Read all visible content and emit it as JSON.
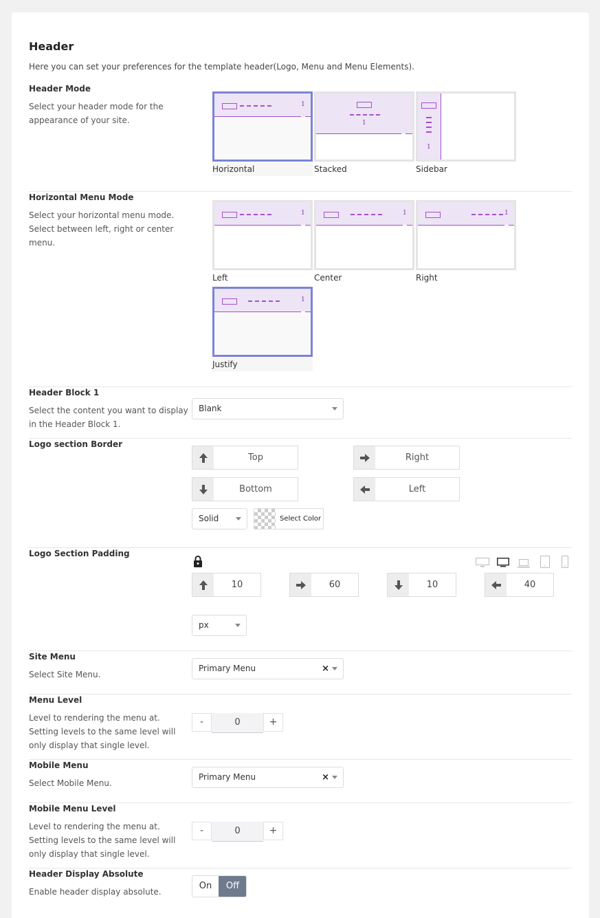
{
  "header": {
    "title": "Header",
    "description": "Here you can set your preferences for the template header(Logo, Menu and Menu Elements)."
  },
  "header_mode": {
    "label": "Header Mode",
    "description": "Select your header mode for the appearance of your site.",
    "options": [
      "Horizontal",
      "Stacked",
      "Sidebar"
    ],
    "selected": "Horizontal",
    "thumb_number": "1"
  },
  "horizontal_menu_mode": {
    "label": "Horizontal Menu Mode",
    "description": "Select your horizontal menu mode. Select between left, right or center menu.",
    "options": [
      "Left",
      "Center",
      "Right",
      "Justify"
    ],
    "selected": "Justify"
  },
  "header_block_1": {
    "label": "Header Block 1",
    "description": "Select the content you want to display in the Header Block 1.",
    "value": "Blank"
  },
  "logo_border": {
    "label": "Logo section Border",
    "top": "Top",
    "right": "Right",
    "bottom": "Bottom",
    "left": "Left",
    "style": "Solid",
    "color_label": "Select Color"
  },
  "logo_padding": {
    "label": "Logo Section Padding",
    "top": "10",
    "right": "60",
    "bottom": "10",
    "left": "40",
    "unit": "px",
    "devices": [
      "desktop-wide-icon",
      "desktop-icon",
      "laptop-icon",
      "tablet-icon",
      "mobile-icon"
    ],
    "active_device": "desktop-icon"
  },
  "site_menu": {
    "label": "Site Menu",
    "description": "Select Site Menu.",
    "value": "Primary Menu",
    "clear": "×"
  },
  "menu_level": {
    "label": "Menu Level",
    "description": "Level to rendering the menu at. Setting levels to the same level will only display that single level.",
    "value": "0",
    "minus": "-",
    "plus": "+"
  },
  "mobile_menu": {
    "label": "Mobile Menu",
    "description": "Select Mobile Menu.",
    "value": "Primary Menu",
    "clear": "×"
  },
  "mobile_menu_level": {
    "label": "Mobile Menu Level",
    "description": "Level to rendering the menu at. Setting levels to the same level will only display that single level.",
    "value": "0",
    "minus": "-",
    "plus": "+"
  },
  "header_absolute": {
    "label": "Header Display Absolute",
    "description": "Enable header display absolute.",
    "on": "On",
    "off": "Off",
    "value": "Off"
  },
  "colors": {
    "accent_purple": "#a64ed1",
    "selected_border": "#7b83d6",
    "toggle_active": "#6e7a8e"
  }
}
